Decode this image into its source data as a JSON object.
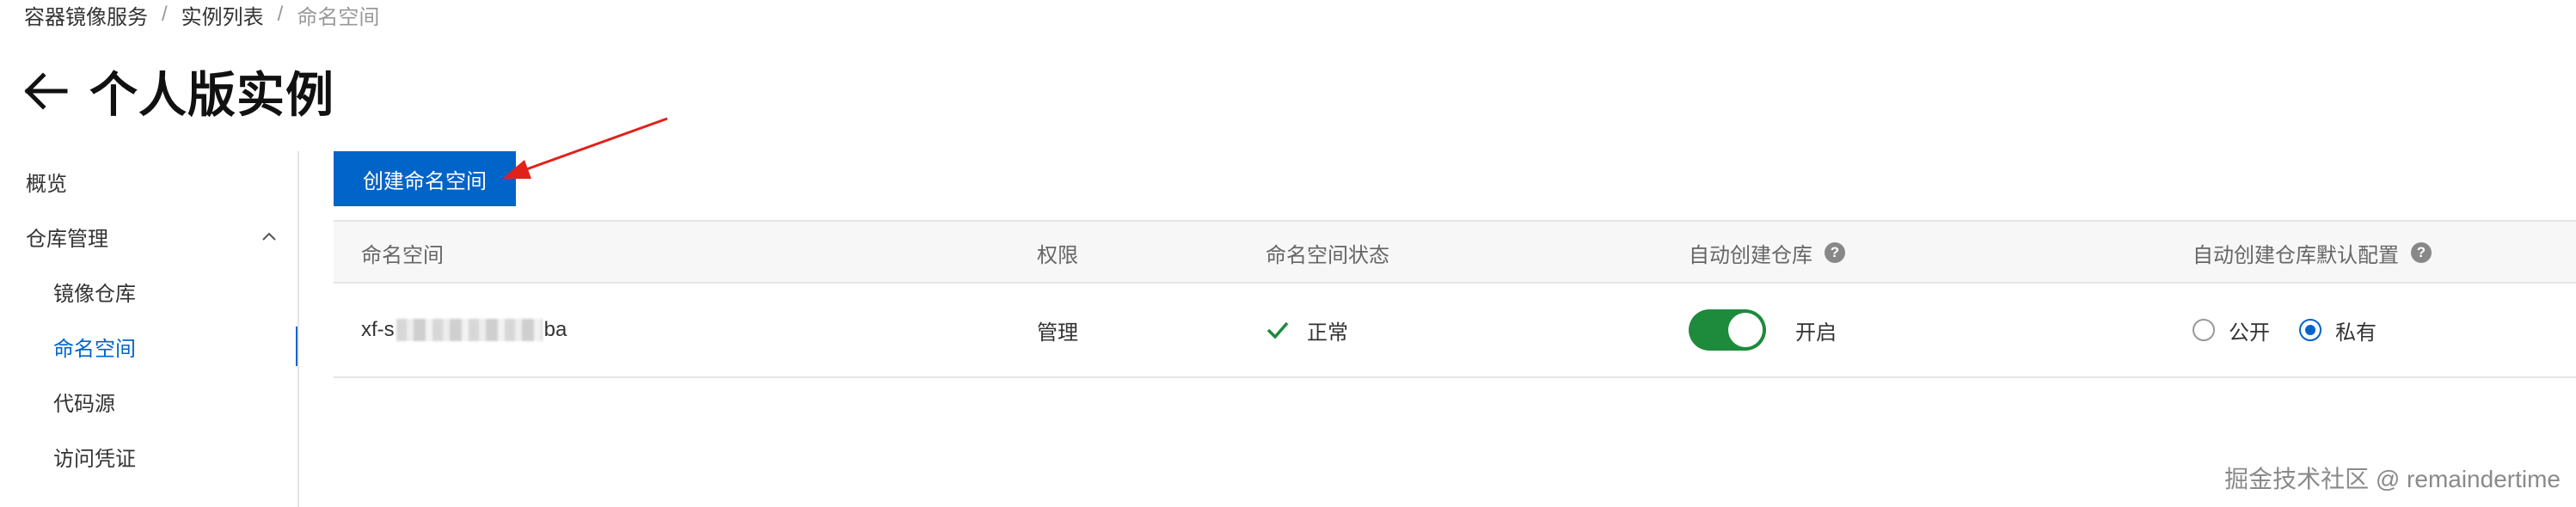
{
  "breadcrumb": [
    "容器镜像服务",
    "实例列表",
    "命名空间"
  ],
  "page_title": "个人版实例",
  "sidebar": {
    "items": [
      {
        "label": "概览"
      },
      {
        "label": "仓库管理"
      },
      {
        "label": "镜像仓库"
      },
      {
        "label": "命名空间"
      },
      {
        "label": "代码源"
      },
      {
        "label": "访问凭证"
      }
    ]
  },
  "toolbar": {
    "create_label": "创建命名空间"
  },
  "table": {
    "columns": [
      "命名空间",
      "权限",
      "命名空间状态",
      "自动创建仓库",
      "自动创建仓库默认配置"
    ],
    "rows": [
      {
        "namespace_prefix": "xf-s",
        "namespace_suffix": "ba",
        "permission": "管理",
        "status": "正常",
        "auto_create": true,
        "auto_create_label": "开启",
        "default_options": [
          "公开",
          "私有"
        ],
        "default_selected": "私有"
      }
    ]
  },
  "colors": {
    "accent": "#0064c8",
    "toggle_on": "#1d8a3c",
    "annotation_arrow": "#e0211a"
  },
  "watermark": "掘金技术社区 @ remaindertime"
}
